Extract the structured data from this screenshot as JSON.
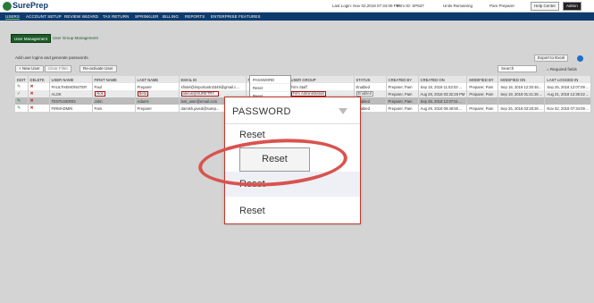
{
  "topbar": {
    "logo": "SurePrep",
    "last_login": "Last Login: Nov 02,2018 07:34:09 PM",
    "firm_id": "Firm ID: SP637",
    "units": "Units Remaining",
    "user_name": "Pam Preparer",
    "help_center": "Help Center",
    "admin": "Admin"
  },
  "nav": [
    "USERS",
    "ACCOUNT SETUP",
    "REVIEW WIZARD",
    "TAX RETURN",
    "SPRINKLER",
    "BILLING",
    "REPORTS",
    "ENTERPRISE FEATURES"
  ],
  "subtabs": {
    "active": "User Management",
    "other": "User Group Management"
  },
  "intro": "Add user logins and generate passwords.",
  "toolbar": {
    "new_user": "+ New User",
    "clear_filter": "Clear Filter",
    "reactivate": "Re-activate User",
    "search": "Search",
    "export": "Export to Excel",
    "required": "= Required fields"
  },
  "table": {
    "headers": [
      "EDIT",
      "DELETE",
      "USER NAME",
      "FIRST NAME",
      "LAST NAME",
      "EMAIL ID",
      "PASSWORD",
      "USER GROUP",
      "STATUS",
      "CREATED BY",
      "CREATED ON",
      "MODIFIED BY",
      "MODIFIED ON",
      "LAST LOGGED IN"
    ],
    "rows": [
      [
        "PAULTHEMONSTER",
        "Paul",
        "Preparer",
        "sfintel@importantn3349@gmail.c...",
        "",
        "Firm Staff",
        "Enabled",
        "Preparer, Pam",
        "Sep 18, 2018 11:53:03 ...",
        "Preparer, Pam",
        "Sep 18, 2018 12:30:46...",
        "Sep 25, 2018 12:07:09 ..."
      ],
      [
        "ALOK",
        "Alok",
        "Beta",
        "alerus@SURETRY...",
        "",
        "Firm Administration",
        "Enabled",
        "Preparer, Pam",
        "Aug 29, 2018 03:32:28 PM",
        "Preparer, Pam",
        "Sep 19, 2018 01:41:25 ...",
        "Aug 31, 2018 12:39:22 ..."
      ],
      [
        "TESTUSER03",
        "John",
        "Adams",
        "test_user@email.com",
        "",
        "Preparer",
        "Enabled",
        "Preparer, Pam",
        "Sep 25, 2018 12:07:51 ...",
        "",
        "",
        ""
      ],
      [
        "FIRMADMIN",
        "Pam",
        "Preparer",
        "damish.javed@surep...",
        "",
        "",
        "Enabled",
        "Preparer, Pam",
        "Aug 29, 2018 09:49:55 ...",
        "Preparer, Pam",
        "Sep 25, 2018 03:28:26 ...",
        "Nov 02, 2018 07:34:09 ..."
      ]
    ]
  },
  "popup_small": {
    "header": "PASSWORD",
    "items": [
      "Reset",
      "Reset"
    ]
  },
  "zoom": {
    "header": "PASSWORD",
    "items": [
      "Reset",
      "Reset",
      "Reset",
      "Reset"
    ]
  },
  "colors": {
    "nav": "#0e3b6e",
    "accent": "#1d5c2a",
    "highlight": "#d9534f"
  }
}
